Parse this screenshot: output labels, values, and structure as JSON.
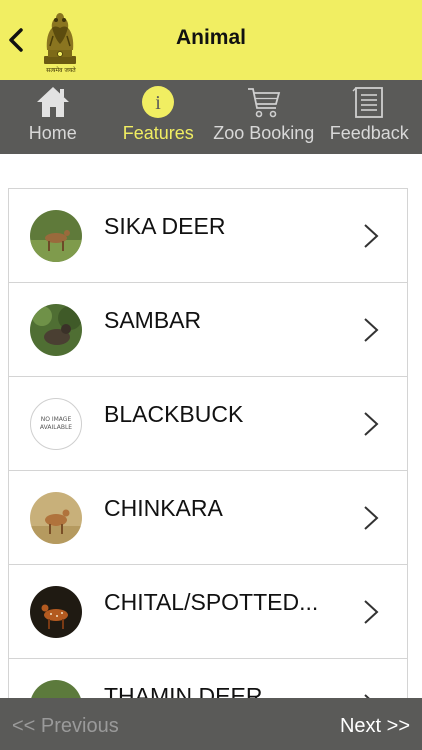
{
  "header": {
    "title": "Animal",
    "emblem_motto": "सत्यमेव जयते",
    "background": "#f1ee62"
  },
  "tabs": [
    {
      "label": "Home",
      "icon": "home-icon",
      "active": false
    },
    {
      "label": "Features",
      "icon": "info-icon",
      "active": true
    },
    {
      "label": "Zoo Booking",
      "icon": "cart-icon",
      "active": false
    },
    {
      "label": "Feedback",
      "icon": "feedback-icon",
      "active": false
    }
  ],
  "colors": {
    "accent": "#f1ee62",
    "bar": "#5a5a58"
  },
  "animals": [
    {
      "name": "SIKA DEER",
      "thumb": "sika-deer-photo"
    },
    {
      "name": "SAMBAR",
      "thumb": "sambar-photo"
    },
    {
      "name": "BLACKBUCK",
      "thumb": "no-image",
      "no_image_text": "NO IMAGE AVAILABLE"
    },
    {
      "name": "CHINKARA",
      "thumb": "chinkara-photo"
    },
    {
      "name": "CHITAL/SPOTTED...",
      "thumb": "chital-photo"
    },
    {
      "name": "THAMIN DEER",
      "thumb": "thamin-deer-photo"
    }
  ],
  "footer": {
    "previous": "<< Previous",
    "next": "Next >>"
  }
}
